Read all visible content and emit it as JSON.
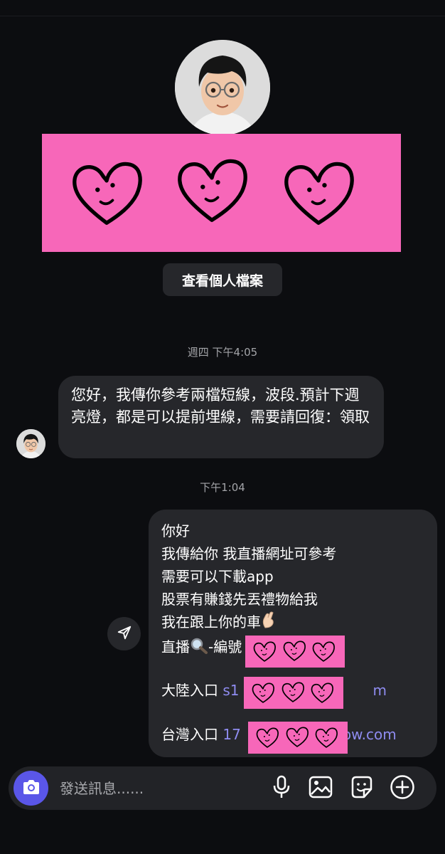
{
  "profile": {
    "view_profile_label": "查看個人檔案"
  },
  "conversation": {
    "timestamp_1": "週四 下午4:05",
    "incoming_message": "您好，我傳你參考兩檔短線，波段.預計下週亮燈，都是可以提前埋線，需要請回復：領取",
    "timestamp_2": "下午1:04",
    "outgoing": {
      "line1": "你好",
      "line2": "我傳給你 我直播網址可參考",
      "line3": "需要可以下載app",
      "line4": "股票有賺錢先丟禮物給我",
      "line5": "我在跟上你的車",
      "line6_prefix": "直播",
      "line6_suffix": "-編號",
      "line7_label": "大陸入口",
      "line7_link": "s1",
      "line7_link_end": "m",
      "line8_label": "台灣入口",
      "line8_link": "17",
      "line8_link_end": "show.com"
    }
  },
  "composer": {
    "placeholder": "發送訊息......"
  },
  "icons": [
    "camera-icon",
    "microphone-icon",
    "gallery-icon",
    "sticker-icon",
    "plus-icon",
    "send-icon",
    "magnifier-emoji",
    "crossed-fingers-emoji",
    "heart-doodle"
  ],
  "colors": {
    "background": "#0c0d10",
    "bubble": "#26272b",
    "sticker_pink": "#f767b9",
    "accent": "#5a56e8",
    "link": "#8f8cf0"
  }
}
